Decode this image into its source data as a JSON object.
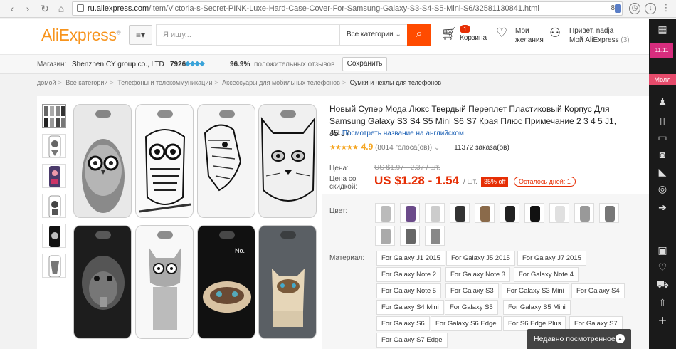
{
  "browser": {
    "url_host": "ru.aliexpress.com",
    "url_path": "/item/Victoria-s-Secret-PINK-Luxe-Hard-Case-Cover-For-Samsung-Galaxy-S3-S4-S5-Mini-S6/32581130841.html",
    "ext_count": "8"
  },
  "header": {
    "logo_main": "AliExpress",
    "logo_tm": "®",
    "search_placeholder": "Я ищу...",
    "category": "Все категории",
    "cart_count": "1",
    "cart_label": "Корзина",
    "wish_line1": "Мои",
    "wish_line2": "желания",
    "user_greeting": "Привет, nadja",
    "user_my": "Мой AliExpress",
    "user_count": "(3)"
  },
  "store": {
    "label": "Магазин:",
    "name": "Shenzhen CY group co., LTD",
    "score": "7926",
    "positive": "96.9%",
    "positive_label": "положительных отзывов",
    "save": "Сохранить"
  },
  "breadcrumb": [
    "домой",
    "Все категории",
    "Телефоны и телекоммуникации",
    "Аксессуары для мобильных телефонов",
    "Сумки и чехлы для телефонов"
  ],
  "product": {
    "title": "Новый Супер Мода Люкс Твердый Переплет Пластиковый Корпус Для Samsung Galaxy S3 S4 S5 Mini S6 S7 Края Плюс Примечание 2 3 4 5 J1, J5 J7",
    "translate": "Посмотреть название на английском",
    "rating": "4.9",
    "votes": "(8014 голоса(ов))",
    "orders": "11372 заказа(ов)",
    "price_label": "Цена:",
    "old_price": "US $1.97 - 2.37 / шт.",
    "discount_label_1": "Цена со",
    "discount_label_2": "скидкой:",
    "new_price": "US $1.28 - 1.54",
    "unit": "/ шт.",
    "discount": "35% off",
    "days_left": "Осталось дней: 1",
    "color_label": "Цвет:",
    "material_label": "Материал:",
    "materials": [
      "For Galaxy J1 2015",
      "For Galaxy J5 2015",
      "For Galaxy J7 2015",
      "For Galaxy Note 2",
      "For Galaxy Note 3",
      "For Galaxy Note 4",
      "For Galaxy Note 5",
      "For Galaxy S3",
      "For Galaxy S3 Mini",
      "For Galaxy S4",
      "For Galaxy S4 Mini",
      "For Galaxy S5",
      "For Galaxy S5 Mini",
      "For Galaxy S6",
      "For Galaxy S6 Edge",
      "For S6 Edge Plus",
      "For Galaxy S7",
      "For Galaxy S7 Edge"
    ]
  },
  "recent": "Недавно посмотренное",
  "sidebar": {
    "promo": "11.11",
    "moll": "Молл"
  },
  "case_art": {
    "monkey_label": "No."
  }
}
